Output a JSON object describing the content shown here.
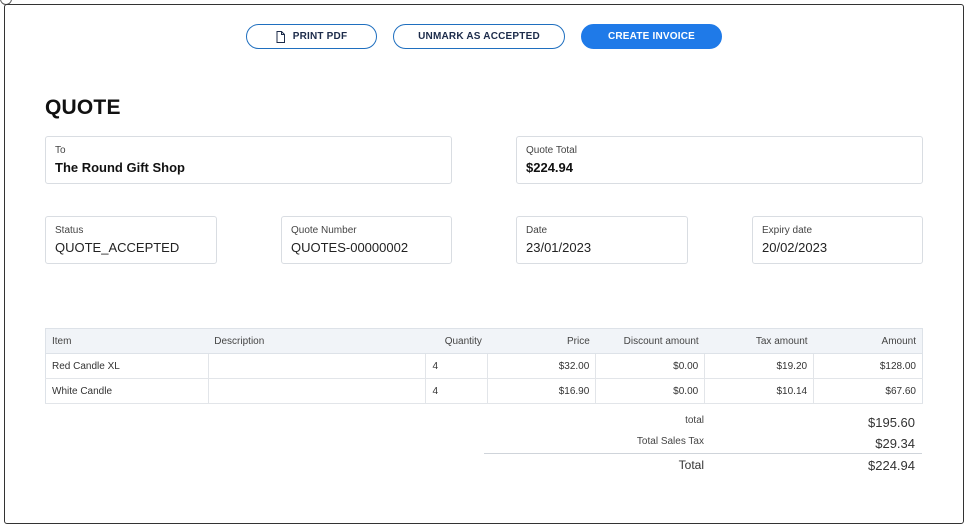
{
  "toolbar": {
    "print_label": "PRINT PDF",
    "unmark_label": "UNMARK AS ACCEPTED",
    "create_invoice_label": "CREATE INVOICE"
  },
  "quote": {
    "heading": "QUOTE",
    "to_label": "To",
    "to_value": "The Round Gift Shop",
    "total_label": "Quote Total",
    "total_value": "$224.94",
    "status_label": "Status",
    "status_value": "QUOTE_ACCEPTED",
    "number_label": "Quote Number",
    "number_value": "QUOTES-00000002",
    "date_label": "Date",
    "date_value": "23/01/2023",
    "expiry_label": "Expiry date",
    "expiry_value": "20/02/2023"
  },
  "table": {
    "columns": [
      "Item",
      "Description",
      "Quantity",
      "Price",
      "Discount amount",
      "Tax amount",
      "Amount"
    ],
    "rows": [
      {
        "item": "Red Candle XL",
        "description": "",
        "quantity": "4",
        "price": "$32.00",
        "discount": "$0.00",
        "tax": "$19.20",
        "amount": "$128.00"
      },
      {
        "item": "White Candle",
        "description": "",
        "quantity": "4",
        "price": "$16.90",
        "discount": "$0.00",
        "tax": "$10.14",
        "amount": "$67.60"
      }
    ]
  },
  "summary": {
    "subtotal_label": "total",
    "subtotal_value": "$195.60",
    "tax_label": "Total Sales Tax",
    "tax_value": "$29.34",
    "grand_label": "Total",
    "grand_value": "$224.94"
  },
  "colors": {
    "accent": "#1f7ae8",
    "outline": "#1f6fbf",
    "border": "#d9dde2",
    "header_bg": "#f1f4f8"
  },
  "icons": {
    "print": "document-icon"
  }
}
